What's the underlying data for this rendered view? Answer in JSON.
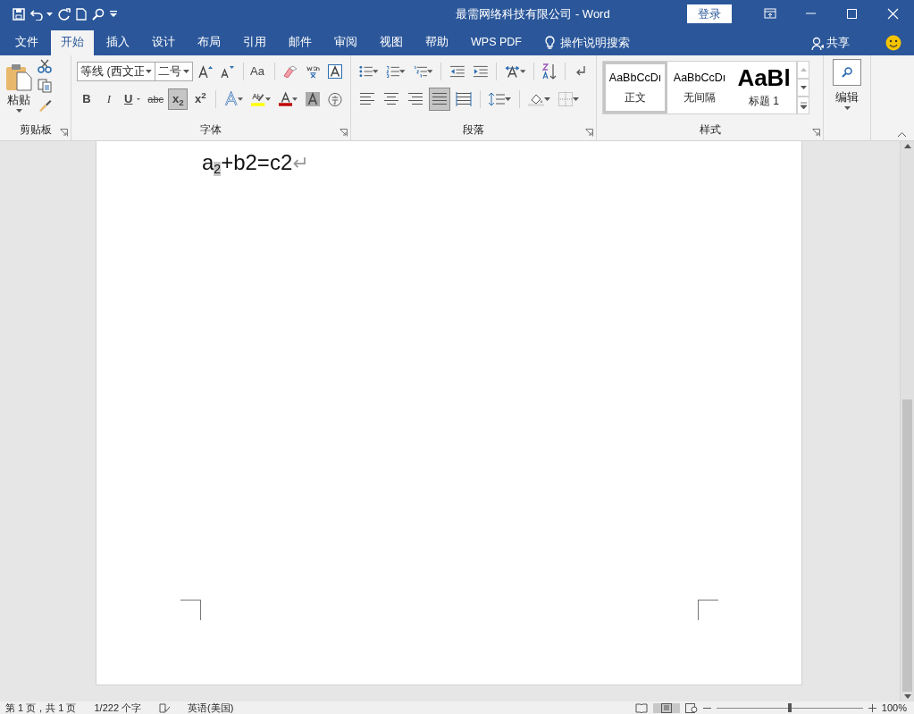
{
  "title_bar": {
    "title": "最需网络科技有限公司  -  Word",
    "login": "登录"
  },
  "tabs": [
    {
      "label": "文件",
      "selected": false
    },
    {
      "label": "开始",
      "selected": true
    },
    {
      "label": "插入",
      "selected": false
    },
    {
      "label": "设计",
      "selected": false
    },
    {
      "label": "布局",
      "selected": false
    },
    {
      "label": "引用",
      "selected": false
    },
    {
      "label": "邮件",
      "selected": false
    },
    {
      "label": "审阅",
      "selected": false
    },
    {
      "label": "视图",
      "selected": false
    },
    {
      "label": "帮助",
      "selected": false
    },
    {
      "label": "WPS PDF",
      "selected": false
    }
  ],
  "tell_me": "操作说明搜索",
  "share": "共享",
  "clipboard": {
    "paste": "粘贴",
    "label": "剪贴板"
  },
  "font": {
    "font_name": "等线 (西文正",
    "font_size": "二号",
    "case_button": "Aa",
    "label": "字体",
    "format_buttons": [
      {
        "label": "B",
        "on": false,
        "has_menu": false
      },
      {
        "label": "I",
        "on": false,
        "has_menu": false
      },
      {
        "label": "U",
        "on": false,
        "has_menu": true
      },
      {
        "label": "abc",
        "on": false,
        "has_menu": false
      },
      {
        "label": "x$_{2}$",
        "on": true,
        "has_menu": false
      },
      {
        "label": "x$^{2}$",
        "on": false,
        "has_menu": false
      }
    ]
  },
  "paragraph": {
    "label": "段落",
    "align_buttons": [
      {
        "kind": "left",
        "selected": false
      },
      {
        "kind": "center",
        "selected": false
      },
      {
        "kind": "right",
        "selected": false
      },
      {
        "kind": "justify",
        "selected": true
      },
      {
        "kind": "distributed",
        "selected": false
      }
    ]
  },
  "styles": {
    "label": "样式",
    "items": [
      {
        "preview": "AaBbCcDı",
        "name": "正文",
        "kind": "normal",
        "selected": true
      },
      {
        "preview": "AaBbCcDı",
        "name": "无间隔",
        "kind": "normal",
        "selected": false
      },
      {
        "preview": "AaBl",
        "name": "标题 1",
        "kind": "heading",
        "selected": false
      }
    ]
  },
  "editing": {
    "label": "编辑"
  },
  "document": {
    "text": "a$_{2}$+b2=c2",
    "paragraph_mark": "↵"
  },
  "status_bar": {
    "page": "第 1 页，共 1 页",
    "words": "1/222 个字",
    "language": "英语(美国)",
    "zoom": "100%",
    "zoom_level": {
      "level": 0.5
    }
  }
}
